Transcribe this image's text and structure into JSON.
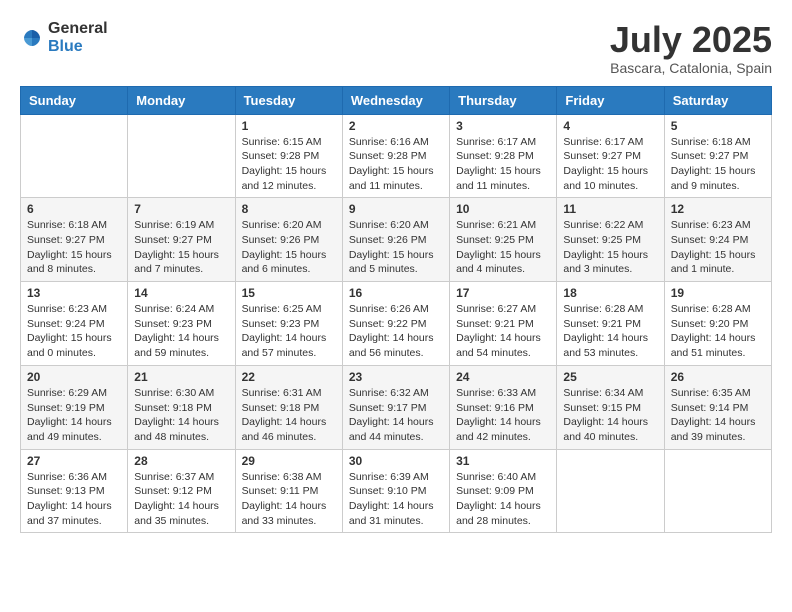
{
  "logo": {
    "general": "General",
    "blue": "Blue"
  },
  "title": {
    "month": "July 2025",
    "location": "Bascara, Catalonia, Spain"
  },
  "weekdays": [
    "Sunday",
    "Monday",
    "Tuesday",
    "Wednesday",
    "Thursday",
    "Friday",
    "Saturday"
  ],
  "weeks": [
    [
      {
        "day": "",
        "info": ""
      },
      {
        "day": "",
        "info": ""
      },
      {
        "day": "1",
        "info": "Sunrise: 6:15 AM\nSunset: 9:28 PM\nDaylight: 15 hours and 12 minutes."
      },
      {
        "day": "2",
        "info": "Sunrise: 6:16 AM\nSunset: 9:28 PM\nDaylight: 15 hours and 11 minutes."
      },
      {
        "day": "3",
        "info": "Sunrise: 6:17 AM\nSunset: 9:28 PM\nDaylight: 15 hours and 11 minutes."
      },
      {
        "day": "4",
        "info": "Sunrise: 6:17 AM\nSunset: 9:27 PM\nDaylight: 15 hours and 10 minutes."
      },
      {
        "day": "5",
        "info": "Sunrise: 6:18 AM\nSunset: 9:27 PM\nDaylight: 15 hours and 9 minutes."
      }
    ],
    [
      {
        "day": "6",
        "info": "Sunrise: 6:18 AM\nSunset: 9:27 PM\nDaylight: 15 hours and 8 minutes."
      },
      {
        "day": "7",
        "info": "Sunrise: 6:19 AM\nSunset: 9:27 PM\nDaylight: 15 hours and 7 minutes."
      },
      {
        "day": "8",
        "info": "Sunrise: 6:20 AM\nSunset: 9:26 PM\nDaylight: 15 hours and 6 minutes."
      },
      {
        "day": "9",
        "info": "Sunrise: 6:20 AM\nSunset: 9:26 PM\nDaylight: 15 hours and 5 minutes."
      },
      {
        "day": "10",
        "info": "Sunrise: 6:21 AM\nSunset: 9:25 PM\nDaylight: 15 hours and 4 minutes."
      },
      {
        "day": "11",
        "info": "Sunrise: 6:22 AM\nSunset: 9:25 PM\nDaylight: 15 hours and 3 minutes."
      },
      {
        "day": "12",
        "info": "Sunrise: 6:23 AM\nSunset: 9:24 PM\nDaylight: 15 hours and 1 minute."
      }
    ],
    [
      {
        "day": "13",
        "info": "Sunrise: 6:23 AM\nSunset: 9:24 PM\nDaylight: 15 hours and 0 minutes."
      },
      {
        "day": "14",
        "info": "Sunrise: 6:24 AM\nSunset: 9:23 PM\nDaylight: 14 hours and 59 minutes."
      },
      {
        "day": "15",
        "info": "Sunrise: 6:25 AM\nSunset: 9:23 PM\nDaylight: 14 hours and 57 minutes."
      },
      {
        "day": "16",
        "info": "Sunrise: 6:26 AM\nSunset: 9:22 PM\nDaylight: 14 hours and 56 minutes."
      },
      {
        "day": "17",
        "info": "Sunrise: 6:27 AM\nSunset: 9:21 PM\nDaylight: 14 hours and 54 minutes."
      },
      {
        "day": "18",
        "info": "Sunrise: 6:28 AM\nSunset: 9:21 PM\nDaylight: 14 hours and 53 minutes."
      },
      {
        "day": "19",
        "info": "Sunrise: 6:28 AM\nSunset: 9:20 PM\nDaylight: 14 hours and 51 minutes."
      }
    ],
    [
      {
        "day": "20",
        "info": "Sunrise: 6:29 AM\nSunset: 9:19 PM\nDaylight: 14 hours and 49 minutes."
      },
      {
        "day": "21",
        "info": "Sunrise: 6:30 AM\nSunset: 9:18 PM\nDaylight: 14 hours and 48 minutes."
      },
      {
        "day": "22",
        "info": "Sunrise: 6:31 AM\nSunset: 9:18 PM\nDaylight: 14 hours and 46 minutes."
      },
      {
        "day": "23",
        "info": "Sunrise: 6:32 AM\nSunset: 9:17 PM\nDaylight: 14 hours and 44 minutes."
      },
      {
        "day": "24",
        "info": "Sunrise: 6:33 AM\nSunset: 9:16 PM\nDaylight: 14 hours and 42 minutes."
      },
      {
        "day": "25",
        "info": "Sunrise: 6:34 AM\nSunset: 9:15 PM\nDaylight: 14 hours and 40 minutes."
      },
      {
        "day": "26",
        "info": "Sunrise: 6:35 AM\nSunset: 9:14 PM\nDaylight: 14 hours and 39 minutes."
      }
    ],
    [
      {
        "day": "27",
        "info": "Sunrise: 6:36 AM\nSunset: 9:13 PM\nDaylight: 14 hours and 37 minutes."
      },
      {
        "day": "28",
        "info": "Sunrise: 6:37 AM\nSunset: 9:12 PM\nDaylight: 14 hours and 35 minutes."
      },
      {
        "day": "29",
        "info": "Sunrise: 6:38 AM\nSunset: 9:11 PM\nDaylight: 14 hours and 33 minutes."
      },
      {
        "day": "30",
        "info": "Sunrise: 6:39 AM\nSunset: 9:10 PM\nDaylight: 14 hours and 31 minutes."
      },
      {
        "day": "31",
        "info": "Sunrise: 6:40 AM\nSunset: 9:09 PM\nDaylight: 14 hours and 28 minutes."
      },
      {
        "day": "",
        "info": ""
      },
      {
        "day": "",
        "info": ""
      }
    ]
  ]
}
